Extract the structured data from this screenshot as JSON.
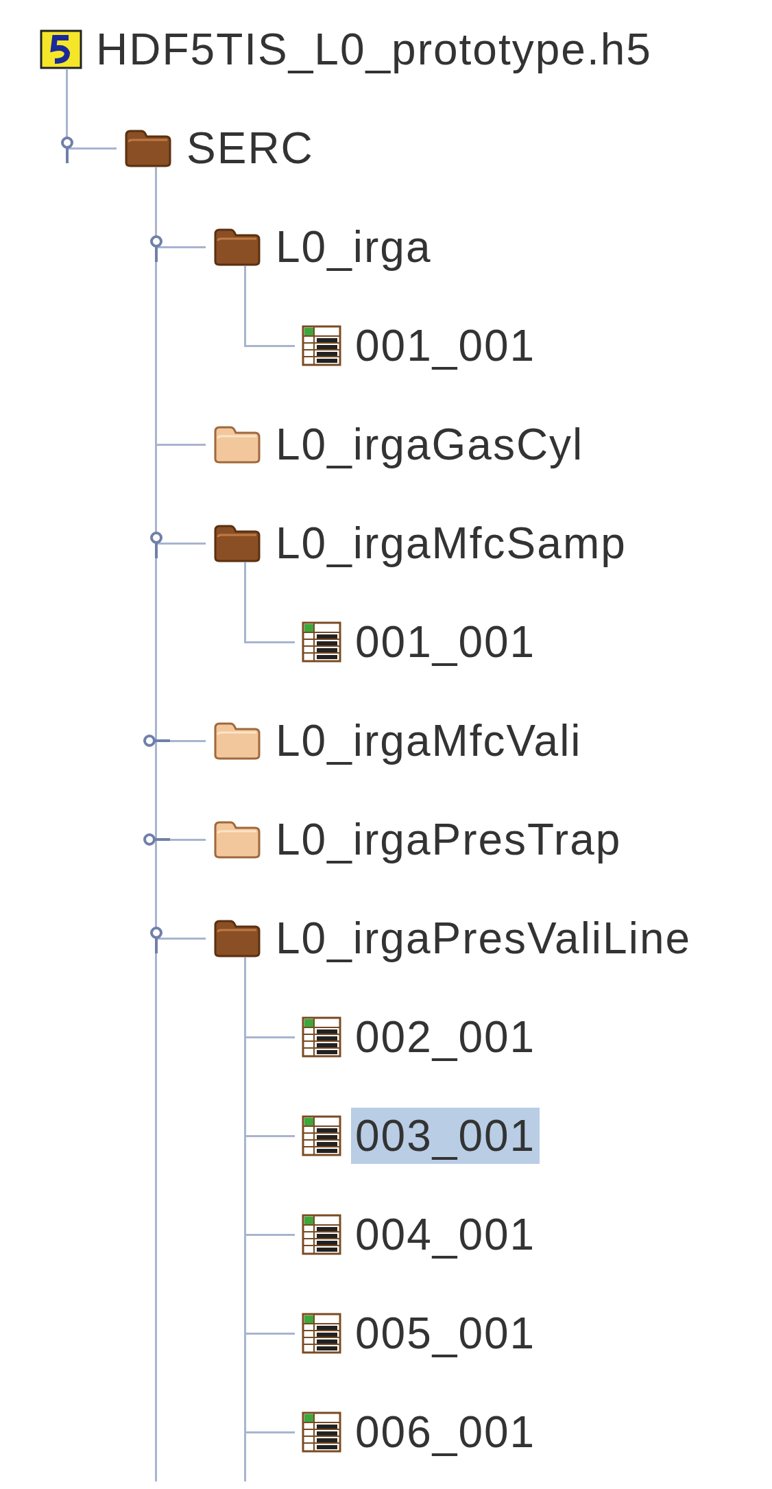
{
  "tree": {
    "label": "HDF5TIS_L0_prototype.h5",
    "kind": "file",
    "children": [
      {
        "label": "SERC",
        "kind": "group",
        "expandable": true,
        "expanded": true,
        "children": [
          {
            "label": "L0_irga",
            "kind": "group",
            "expandable": true,
            "expanded": true,
            "children": [
              {
                "label": "001_001",
                "kind": "dataset",
                "selected": false
              }
            ]
          },
          {
            "label": "L0_irgaGasCyl",
            "kind": "group",
            "expandable": false,
            "expanded": false
          },
          {
            "label": "L0_irgaMfcSamp",
            "kind": "group",
            "expandable": true,
            "expanded": true,
            "children": [
              {
                "label": "001_001",
                "kind": "dataset",
                "selected": false
              }
            ]
          },
          {
            "label": "L0_irgaMfcVali",
            "kind": "group",
            "expandable": true,
            "expanded": false
          },
          {
            "label": "L0_irgaPresTrap",
            "kind": "group",
            "expandable": true,
            "expanded": false
          },
          {
            "label": "L0_irgaPresValiLine",
            "kind": "group",
            "expandable": true,
            "expanded": true,
            "children": [
              {
                "label": "002_001",
                "kind": "dataset",
                "selected": false
              },
              {
                "label": "003_001",
                "kind": "dataset",
                "selected": true
              },
              {
                "label": "004_001",
                "kind": "dataset",
                "selected": false
              },
              {
                "label": "005_001",
                "kind": "dataset",
                "selected": false
              },
              {
                "label": "006_001",
                "kind": "dataset",
                "selected": false
              }
            ]
          }
        ]
      }
    ]
  }
}
